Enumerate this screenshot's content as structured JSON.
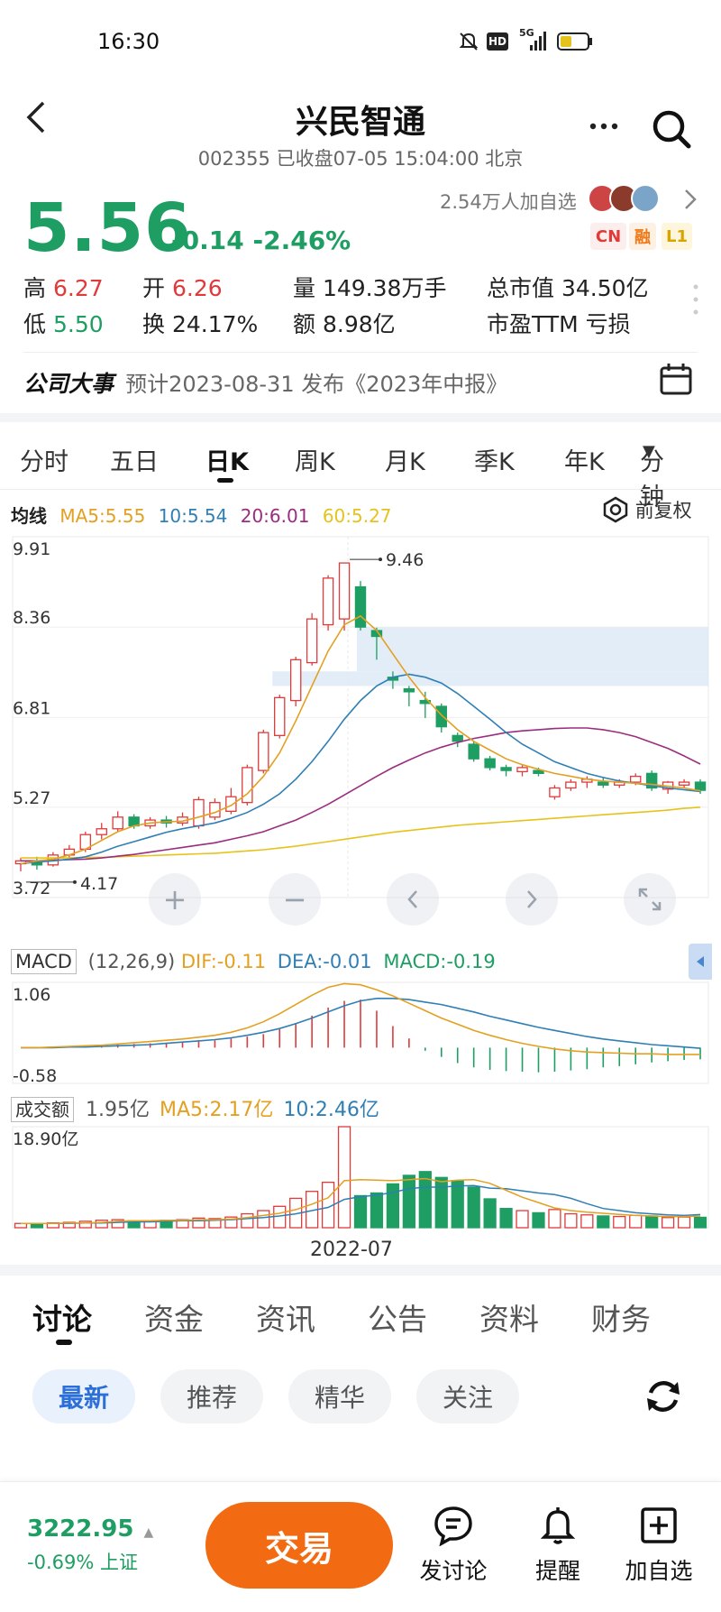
{
  "status_bar": {
    "time": "16:30",
    "network": "5G",
    "hd": "HD"
  },
  "header": {
    "title": "兴民智通",
    "subtitle": "002355 已收盘07-05 15:04:00 北京",
    "more_icon": "more-dots-icon",
    "search_icon": "search-icon"
  },
  "quote": {
    "price": "5.56",
    "change": "-0.14",
    "change_pct": "-2.46%",
    "followers": "2.54万人加自选",
    "badges": [
      "CN",
      "融",
      "L1"
    ],
    "stats": [
      {
        "label": "高",
        "value": "6.27",
        "tone": "red"
      },
      {
        "label": "开",
        "value": "6.26",
        "tone": "red"
      },
      {
        "label": "量",
        "value": "149.38万手",
        "tone": "normal"
      },
      {
        "label": "总市值",
        "value": "34.50亿",
        "tone": "normal"
      },
      {
        "label": "低",
        "value": "5.50",
        "tone": "green"
      },
      {
        "label": "换",
        "value": "24.17%",
        "tone": "normal"
      },
      {
        "label": "额",
        "value": "8.98亿",
        "tone": "normal"
      },
      {
        "label": "市盈TTM",
        "value": "亏损",
        "tone": "normal"
      }
    ]
  },
  "event": {
    "title": "公司大事",
    "text": "预计2023-08-31 发布《2023年中报》"
  },
  "period_tabs": [
    "分时",
    "五日",
    "日K",
    "周K",
    "月K",
    "季K",
    "年K",
    "分钟"
  ],
  "active_period": "日K",
  "ma_legend": {
    "label": "均线",
    "ma5": "MA5:5.55",
    "ma10": "10:5.54",
    "ma20": "20:6.01",
    "ma60": "60:5.27",
    "adjust": "前复权"
  },
  "colors": {
    "up": "#e03a3a",
    "down": "#1e9e62",
    "ma5": "#e3a021",
    "ma10": "#2f7fb5",
    "ma20": "#9b2d7f",
    "ma60": "#e6c31c"
  },
  "chart_data": {
    "type": "candlestick",
    "y_ticks": [
      "9.91",
      "8.36",
      "6.81",
      "5.27",
      "3.72"
    ],
    "ylim": [
      3.72,
      9.91
    ],
    "max_label": "9.46",
    "min_label": "4.17",
    "x_tick": "2022-07",
    "candles": [
      [
        4.3,
        4.35,
        4.17,
        4.4
      ],
      [
        4.35,
        4.28,
        4.2,
        4.42
      ],
      [
        4.28,
        4.45,
        4.25,
        4.5
      ],
      [
        4.45,
        4.55,
        4.4,
        4.62
      ],
      [
        4.55,
        4.8,
        4.5,
        4.85
      ],
      [
        4.8,
        4.9,
        4.72,
        5.0
      ],
      [
        4.9,
        5.1,
        4.85,
        5.2
      ],
      [
        5.1,
        4.95,
        4.9,
        5.15
      ],
      [
        4.95,
        5.05,
        4.9,
        5.1
      ],
      [
        5.05,
        5.0,
        4.92,
        5.12
      ],
      [
        5.0,
        5.1,
        4.95,
        5.18
      ],
      [
        4.95,
        5.4,
        4.9,
        5.45
      ],
      [
        5.1,
        5.35,
        5.05,
        5.42
      ],
      [
        5.2,
        5.45,
        5.15,
        5.6
      ],
      [
        5.35,
        5.95,
        5.3,
        6.0
      ],
      [
        5.9,
        6.55,
        5.85,
        6.6
      ],
      [
        6.5,
        7.15,
        6.45,
        7.2
      ],
      [
        7.1,
        7.8,
        7.0,
        7.85
      ],
      [
        7.75,
        8.5,
        7.7,
        8.6
      ],
      [
        8.4,
        9.2,
        8.3,
        9.25
      ],
      [
        8.5,
        9.46,
        8.3,
        9.46
      ],
      [
        9.05,
        8.36,
        8.3,
        9.15
      ],
      [
        8.3,
        8.2,
        7.8,
        8.35
      ],
      [
        7.5,
        7.45,
        7.3,
        7.6
      ],
      [
        7.3,
        7.25,
        7.0,
        7.35
      ],
      [
        7.1,
        7.05,
        6.8,
        7.25
      ],
      [
        7.0,
        6.65,
        6.55,
        7.05
      ],
      [
        6.5,
        6.4,
        6.3,
        6.55
      ],
      [
        6.35,
        6.1,
        6.05,
        6.4
      ],
      [
        6.1,
        5.95,
        5.9,
        6.15
      ],
      [
        5.95,
        5.9,
        5.8,
        6.0
      ],
      [
        5.88,
        5.95,
        5.8,
        6.0
      ],
      [
        5.9,
        5.85,
        5.8,
        5.95
      ],
      [
        5.45,
        5.6,
        5.4,
        5.65
      ],
      [
        5.6,
        5.7,
        5.55,
        5.75
      ],
      [
        5.7,
        5.75,
        5.6,
        5.8
      ],
      [
        5.7,
        5.65,
        5.6,
        5.78
      ],
      [
        5.65,
        5.7,
        5.6,
        5.75
      ],
      [
        5.7,
        5.8,
        5.65,
        5.85
      ],
      [
        5.85,
        5.6,
        5.55,
        5.9
      ],
      [
        5.58,
        5.7,
        5.5,
        5.72
      ],
      [
        5.65,
        5.7,
        5.6,
        5.75
      ],
      [
        5.7,
        5.56,
        5.5,
        5.75
      ]
    ],
    "ma5": [
      4.3,
      4.35,
      4.38,
      4.45,
      4.55,
      4.7,
      4.85,
      4.95,
      5.0,
      5.02,
      5.03,
      5.1,
      5.18,
      5.3,
      5.5,
      5.8,
      6.2,
      6.75,
      7.35,
      7.95,
      8.4,
      8.55,
      8.3,
      7.9,
      7.5,
      7.15,
      6.85,
      6.6,
      6.4,
      6.25,
      6.1,
      6.0,
      5.92,
      5.85,
      5.8,
      5.75,
      5.72,
      5.7,
      5.68,
      5.66,
      5.63,
      5.6,
      5.55
    ],
    "ma10": [
      4.3,
      4.33,
      4.35,
      4.38,
      4.42,
      4.5,
      4.6,
      4.68,
      4.76,
      4.84,
      4.9,
      4.95,
      5.0,
      5.08,
      5.18,
      5.32,
      5.5,
      5.75,
      6.05,
      6.4,
      6.78,
      7.1,
      7.35,
      7.5,
      7.55,
      7.5,
      7.4,
      7.22,
      7.0,
      6.78,
      6.55,
      6.35,
      6.2,
      6.05,
      5.95,
      5.85,
      5.78,
      5.72,
      5.68,
      5.64,
      5.6,
      5.57,
      5.54
    ],
    "ma20": [
      4.35,
      4.35,
      4.36,
      4.37,
      4.38,
      4.4,
      4.43,
      4.46,
      4.5,
      4.54,
      4.58,
      4.62,
      4.66,
      4.72,
      4.78,
      4.85,
      4.95,
      5.05,
      5.18,
      5.32,
      5.48,
      5.64,
      5.8,
      5.95,
      6.08,
      6.2,
      6.3,
      6.38,
      6.45,
      6.5,
      6.55,
      6.58,
      6.6,
      6.62,
      6.63,
      6.63,
      6.6,
      6.55,
      6.48,
      6.38,
      6.28,
      6.15,
      6.01
    ],
    "ma60": [
      4.4,
      4.4,
      4.4,
      4.4,
      4.41,
      4.41,
      4.42,
      4.43,
      4.44,
      4.45,
      4.46,
      4.47,
      4.48,
      4.5,
      4.52,
      4.54,
      4.57,
      4.6,
      4.64,
      4.68,
      4.72,
      4.76,
      4.8,
      4.84,
      4.87,
      4.9,
      4.93,
      4.96,
      4.98,
      5.0,
      5.02,
      5.04,
      5.06,
      5.08,
      5.1,
      5.12,
      5.14,
      5.16,
      5.18,
      5.2,
      5.22,
      5.25,
      5.27
    ]
  },
  "macd": {
    "label": "MACD",
    "params": "(12,26,9)",
    "dif": "DIF:-0.11",
    "dea": "DEA:-0.01",
    "macd": "MACD:-0.19",
    "y_top": "1.06",
    "y_bottom": "-0.58",
    "ylim": [
      -0.58,
      1.06
    ],
    "bars": [
      0.0,
      0.0,
      0.01,
      0.02,
      0.03,
      0.04,
      0.05,
      0.06,
      0.07,
      0.08,
      0.09,
      0.1,
      0.12,
      0.15,
      0.18,
      0.22,
      0.3,
      0.4,
      0.52,
      0.65,
      0.76,
      0.78,
      0.6,
      0.35,
      0.15,
      -0.05,
      -0.15,
      -0.25,
      -0.32,
      -0.36,
      -0.38,
      -0.39,
      -0.4,
      -0.39,
      -0.37,
      -0.35,
      -0.32,
      -0.3,
      -0.27,
      -0.24,
      -0.22,
      -0.2,
      -0.19
    ],
    "dif_line": [
      0.0,
      0.0,
      0.01,
      0.02,
      0.03,
      0.04,
      0.06,
      0.08,
      0.1,
      0.12,
      0.14,
      0.17,
      0.2,
      0.25,
      0.32,
      0.42,
      0.55,
      0.7,
      0.85,
      0.98,
      1.04,
      1.02,
      0.94,
      0.84,
      0.72,
      0.6,
      0.48,
      0.38,
      0.28,
      0.2,
      0.13,
      0.07,
      0.02,
      -0.02,
      -0.05,
      -0.07,
      -0.08,
      -0.09,
      -0.1,
      -0.1,
      -0.11,
      -0.11,
      -0.11
    ],
    "dea_line": [
      0.0,
      0.0,
      0.0,
      0.01,
      0.01,
      0.02,
      0.03,
      0.04,
      0.05,
      0.07,
      0.09,
      0.11,
      0.13,
      0.16,
      0.2,
      0.25,
      0.31,
      0.39,
      0.48,
      0.58,
      0.68,
      0.76,
      0.8,
      0.8,
      0.78,
      0.74,
      0.7,
      0.64,
      0.58,
      0.51,
      0.45,
      0.39,
      0.33,
      0.28,
      0.23,
      0.18,
      0.14,
      0.11,
      0.08,
      0.05,
      0.03,
      0.01,
      -0.01
    ]
  },
  "volume": {
    "label": "成交额",
    "value": "1.95亿",
    "ma5": "MA5:2.17亿",
    "ma10": "10:2.46亿",
    "y_top": "18.90亿",
    "ymax": 18.9,
    "bars": [
      0.8,
      0.7,
      0.9,
      1.0,
      1.2,
      1.4,
      1.5,
      1.3,
      1.2,
      1.4,
      1.5,
      1.8,
      1.7,
      2.0,
      2.6,
      3.2,
      4.0,
      5.5,
      6.8,
      8.5,
      18.9,
      6.0,
      6.5,
      8.2,
      9.8,
      10.5,
      9.4,
      8.8,
      7.6,
      5.4,
      3.6,
      3.2,
      2.8,
      3.4,
      2.6,
      2.4,
      2.2,
      2.1,
      2.3,
      2.2,
      1.9,
      2.0,
      1.95
    ],
    "ma5_line": [
      0.8,
      0.8,
      0.8,
      0.9,
      0.9,
      1.0,
      1.2,
      1.3,
      1.3,
      1.4,
      1.4,
      1.5,
      1.5,
      1.6,
      1.9,
      2.3,
      2.7,
      3.4,
      4.4,
      5.6,
      8.8,
      9.0,
      8.9,
      8.8,
      9.0,
      9.2,
      8.6,
      8.9,
      9.0,
      8.3,
      7.0,
      5.7,
      4.7,
      3.7,
      3.2,
      2.9,
      2.7,
      2.5,
      2.3,
      2.2,
      2.1,
      2.1,
      2.17
    ],
    "ma10_line": [
      0.8,
      0.8,
      0.8,
      0.8,
      0.9,
      0.9,
      1.0,
      1.1,
      1.1,
      1.2,
      1.3,
      1.3,
      1.4,
      1.5,
      1.7,
      1.9,
      2.2,
      2.6,
      3.2,
      3.8,
      5.3,
      5.8,
      6.1,
      6.6,
      7.3,
      7.6,
      7.6,
      7.8,
      7.9,
      7.4,
      7.3,
      6.9,
      6.5,
      6.2,
      5.5,
      4.5,
      3.6,
      3.2,
      2.8,
      2.6,
      2.4,
      2.3,
      2.46
    ]
  },
  "content_tabs": [
    "讨论",
    "资金",
    "资讯",
    "公告",
    "资料",
    "财务"
  ],
  "active_content_tab": "讨论",
  "filter_chips": [
    "最新",
    "推荐",
    "精华",
    "关注"
  ],
  "active_chip": "最新",
  "bottom_bar": {
    "index_value": "3222.95",
    "index_change": "-0.69% 上证",
    "trade_button": "交易",
    "discuss": "发讨论",
    "remind": "提醒",
    "add": "加自选"
  }
}
